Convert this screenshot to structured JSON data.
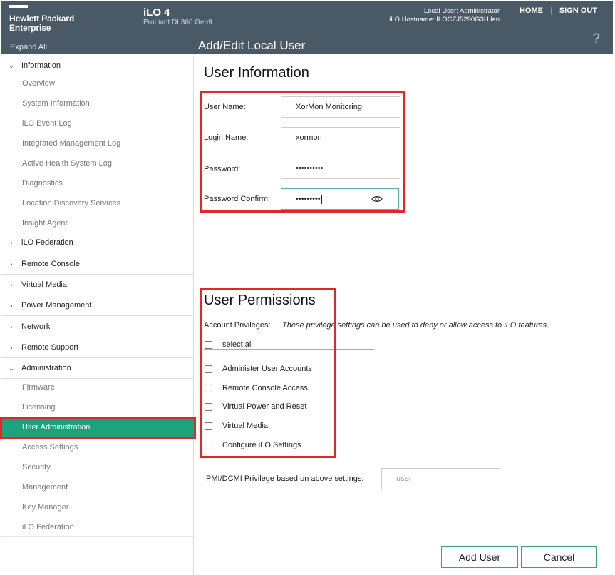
{
  "header": {
    "logo_line1": "Hewlett Packard",
    "logo_line2": "Enterprise",
    "product": "iLO 4",
    "model": "ProLiant DL360 Gen9",
    "local_user": "Local User: Administrator",
    "hostname": "iLO Hostname: ILOCZJ5290G3H.lan",
    "home": "HOME",
    "sign_out": "SIGN OUT",
    "expand_all": "Expand All",
    "page_title": "Add/Edit Local User",
    "help": "?"
  },
  "sidebar": {
    "information": "Information",
    "information_items": [
      "Overview",
      "System Information",
      "iLO Event Log",
      "Integrated Management Log",
      "Active Health System Log",
      "Diagnostics",
      "Location Discovery Services",
      "Insight Agent"
    ],
    "collapsed_groups": [
      "iLO Federation",
      "Remote Console",
      "Virtual Media",
      "Power Management",
      "Network",
      "Remote Support"
    ],
    "administration": "Administration",
    "administration_items": [
      "Firmware",
      "Licensing",
      "User Administration",
      "Access Settings",
      "Security",
      "Management",
      "Key Manager",
      "iLO Federation"
    ],
    "active_item": "User Administration"
  },
  "user_info": {
    "title": "User Information",
    "user_name_label": "User Name:",
    "user_name_value": "XorMon Monitoring",
    "login_name_label": "Login Name:",
    "login_name_value": "xormon",
    "password_label": "Password:",
    "password_value": "••••••••••",
    "password_confirm_label": "Password Confirm:",
    "password_confirm_value": "•••••••••"
  },
  "permissions": {
    "title": "User Permissions",
    "account_privileges_label": "Account Privileges:",
    "description": "These privilege settings can be used to deny or allow access to iLO features.",
    "select_all": "select all",
    "items": [
      "Administer User Accounts",
      "Remote Console Access",
      "Virtual Power and Reset",
      "Virtual Media",
      "Configure iLO Settings"
    ],
    "ipmi_label": "IPMI/DCMI Privilege based on above settings:",
    "ipmi_value": "user"
  },
  "buttons": {
    "add_user": "Add User",
    "cancel": "Cancel"
  },
  "colors": {
    "header_bg": "#4a5966",
    "active_nav": "#1aa37d",
    "highlight": "#e0282b",
    "button_border": "#3fa07f"
  }
}
